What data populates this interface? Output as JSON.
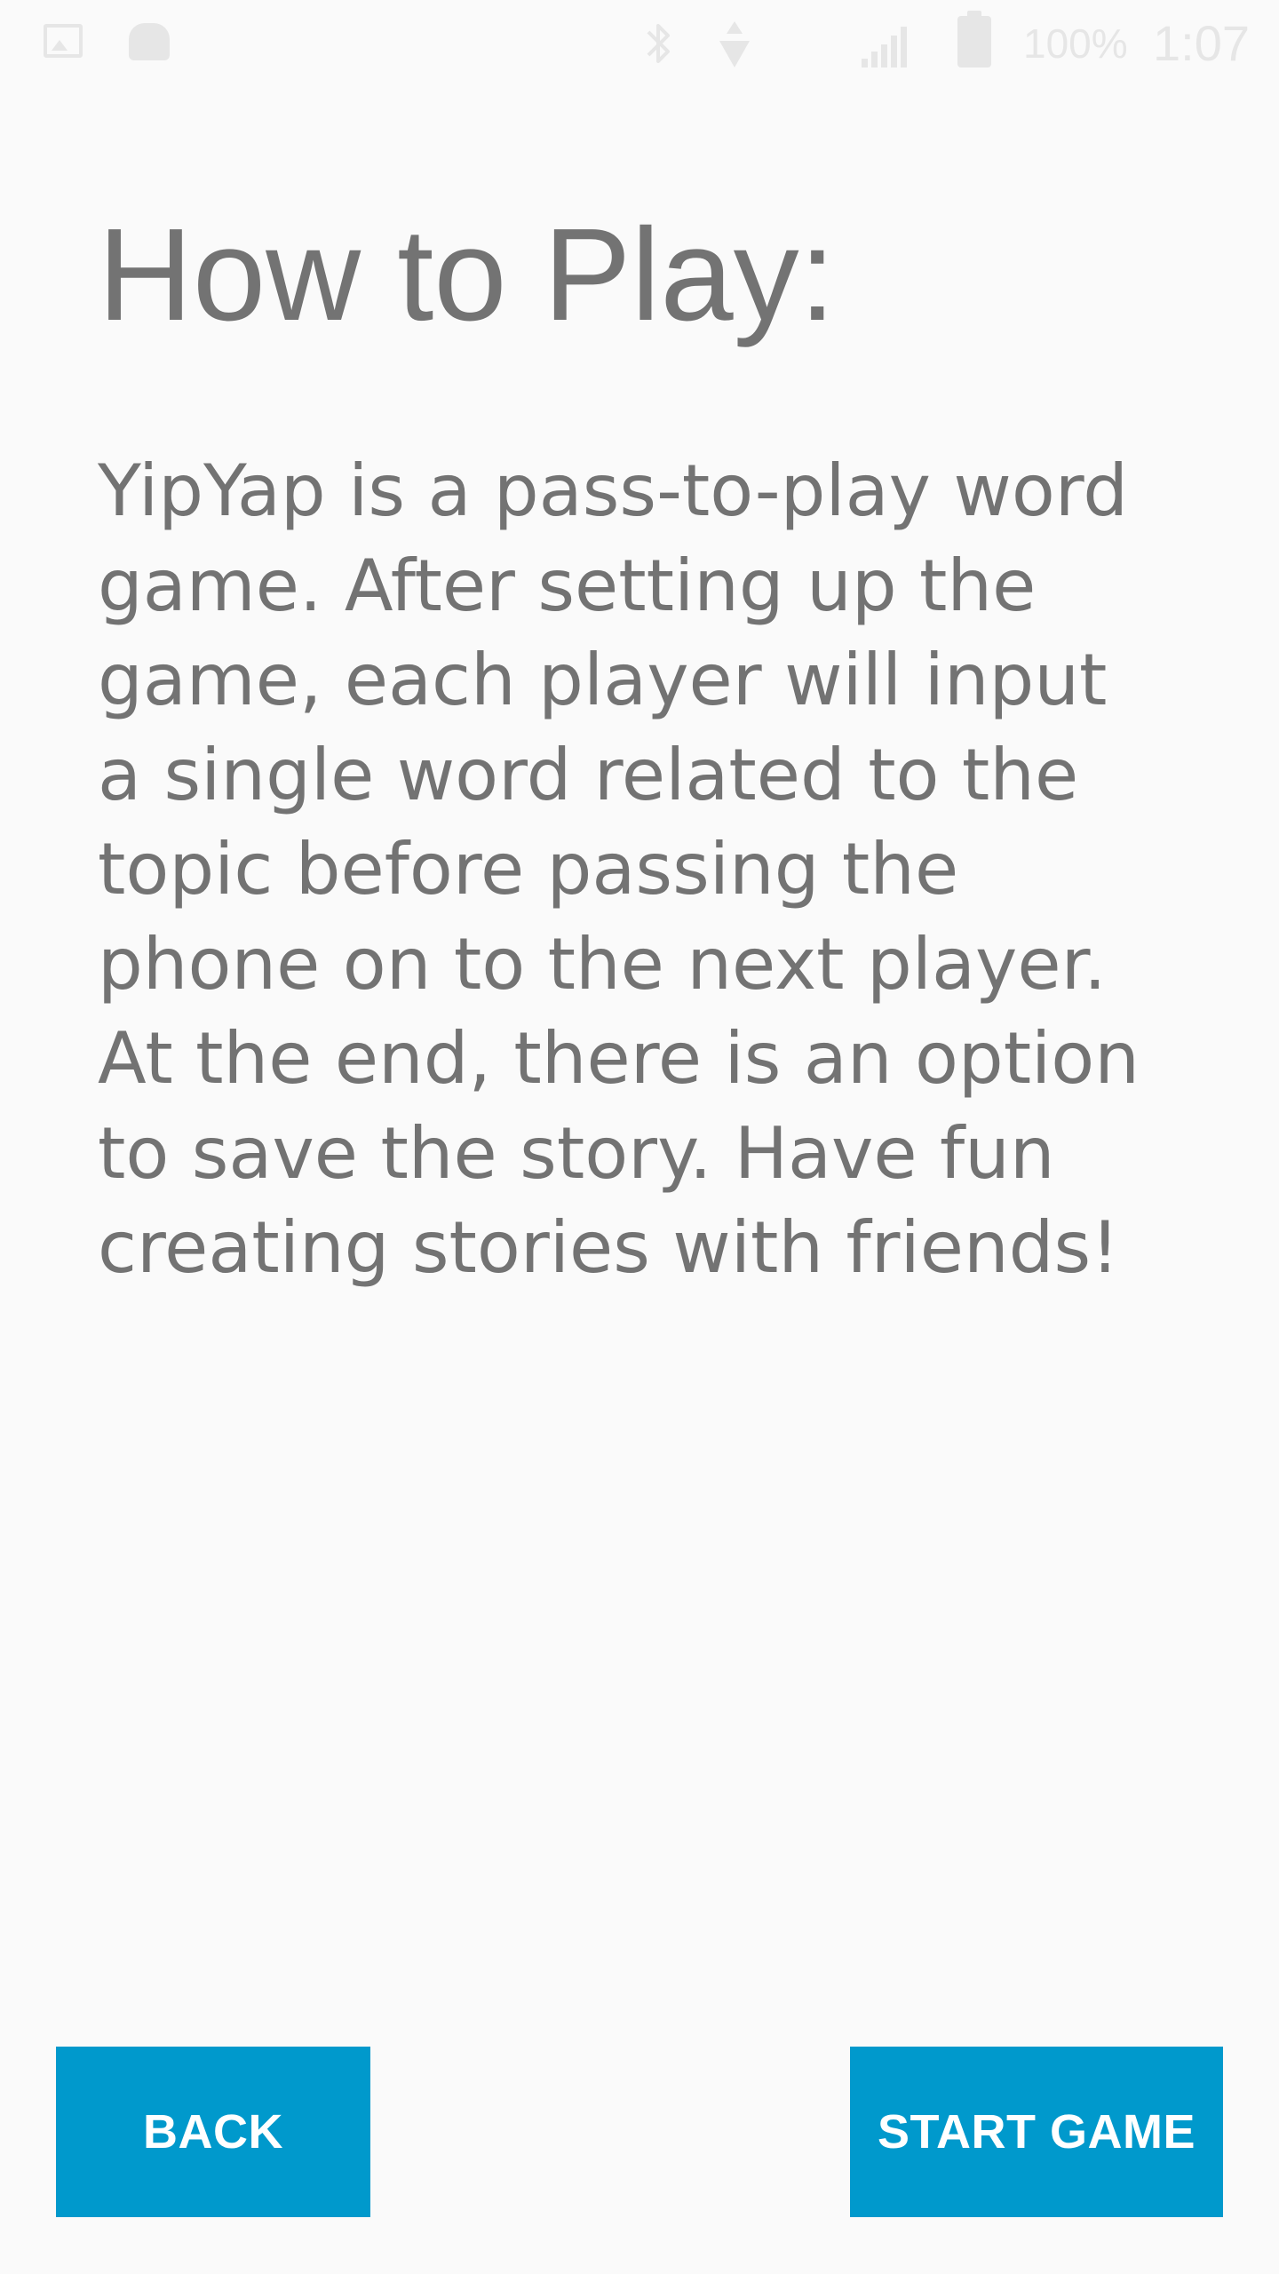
{
  "status_bar": {
    "icons_left": [
      "gallery-icon",
      "android-icon"
    ],
    "icons_right": [
      "bluetooth-icon",
      "wifi-icon",
      "signal-icon",
      "battery-icon"
    ],
    "battery_percent": "100%",
    "clock": "1:07"
  },
  "screen": {
    "title": "How to Play:",
    "instructions_lines": [
      "YipYap is a pass-to-play word",
      "game. After setting up the",
      "game, each player will input",
      "a single word related to the",
      "topic before passing the",
      "phone on to the next player.",
      "At the end, there is an option",
      "to save the story. Have fun",
      "creating stories with friends!"
    ]
  },
  "buttons": {
    "back_label": "BACK",
    "start_label": "START GAME"
  },
  "colors": {
    "background": "#fafafa",
    "text": "#737373",
    "button": "#0099cc",
    "button_text": "#ffffff",
    "status_icons": "#e6e6e6"
  }
}
